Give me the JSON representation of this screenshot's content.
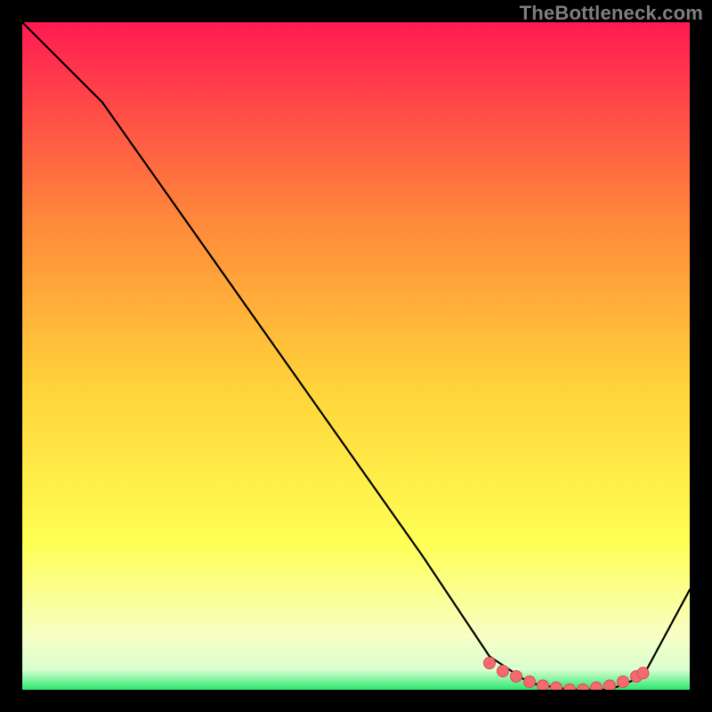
{
  "watermark": "TheBottleneck.com",
  "colors": {
    "black": "#000000",
    "line": "#000000",
    "dot_fill": "#f46a6f",
    "dot_stroke": "#d24f54",
    "grad_top": "#ff1a52",
    "grad_mid_upper": "#ff6a3a",
    "grad_mid": "#ffd43a",
    "grad_low_yellow": "#ffff55",
    "grad_pale": "#f7ffc5",
    "grad_green": "#2ae86d"
  },
  "chart_data": {
    "type": "line",
    "title": "",
    "xlabel": "",
    "ylabel": "",
    "xlim": [
      0,
      100
    ],
    "ylim": [
      0,
      100
    ],
    "series": [
      {
        "name": "curve",
        "x": [
          0,
          8,
          12,
          60,
          70,
          76,
          82,
          88,
          93,
          100
        ],
        "y": [
          100,
          92,
          88,
          20,
          5,
          1,
          0,
          0,
          2,
          15
        ]
      }
    ],
    "markers": {
      "name": "highlight-dots",
      "x": [
        70,
        72,
        74,
        76,
        78,
        80,
        82,
        84,
        86,
        88,
        90,
        92,
        93
      ],
      "y": [
        4.0,
        2.8,
        2.0,
        1.2,
        0.6,
        0.3,
        0.0,
        0.0,
        0.3,
        0.6,
        1.2,
        2.0,
        2.5
      ]
    }
  }
}
